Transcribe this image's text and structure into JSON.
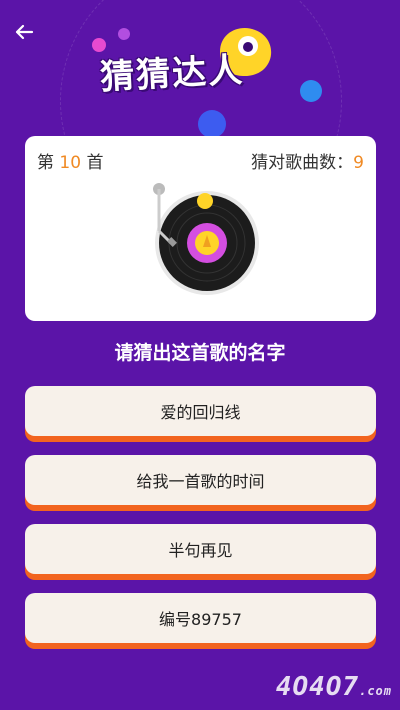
{
  "header": {
    "title": "猜猜达人",
    "back_icon": "arrow-left-icon"
  },
  "card": {
    "question_prefix": "第",
    "question_number": "10",
    "question_suffix": "首",
    "score_label": "猜对歌曲数：",
    "score_value": "9"
  },
  "prompt": "请猜出这首歌的名字",
  "options": [
    {
      "label": "爱的回归线"
    },
    {
      "label": "给我一首歌的时间"
    },
    {
      "label": "半句再见"
    },
    {
      "label": "编号89757"
    }
  ],
  "watermark": {
    "main": "4O4O7",
    "suffix": ".com"
  },
  "colors": {
    "background": "#5b14a8",
    "accent": "#f08a24",
    "option_bg": "#f7f1ea",
    "option_shadow": "#f2641f"
  }
}
